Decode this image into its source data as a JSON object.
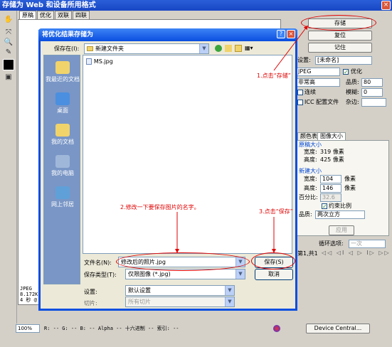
{
  "window": {
    "title": "存储为 Web 和设备所用格式",
    "close": "×"
  },
  "preview_tabs": [
    "原稿",
    "优化",
    "双联",
    "四联"
  ],
  "preview_info": [
    "JPEG",
    "8.172K",
    "4 秒 @"
  ],
  "right_panel": {
    "save_button": "存储",
    "reset_button": "复位",
    "remember_button": "记住",
    "preset_label": "设置:",
    "preset_value": "[未命名]",
    "format_value": "JPEG",
    "optimized_label": "优化",
    "quality_preset": "非常高",
    "quality_label": "品质:",
    "quality_value": "80",
    "progressive_label": "连续",
    "blur_label": "模糊:",
    "blur_value": "0",
    "icc_label": "ICC 配置文件",
    "matte_label": "杂边:",
    "tabs": [
      "颜色表",
      "图像大小"
    ],
    "original_size_title": "原稿大小",
    "orig_width_label": "宽度:",
    "orig_width_value": "319 像素",
    "orig_height_label": "高度:",
    "orig_height_value": "425 像素",
    "new_size_title": "新建大小",
    "new_width_label": "宽度:",
    "new_width_value": "104",
    "new_width_unit": "像素",
    "new_height_label": "高度:",
    "new_height_value": "146",
    "new_height_unit": "像素",
    "percent_label": "百分比:",
    "percent_value": "32.6",
    "constrain_label": "约束比例",
    "quality2_label": "品质:",
    "quality2_value": "两次立方",
    "apply_button": "应用",
    "loop_label": "循环选项:",
    "loop_value": "一次",
    "frame_label": "第1,共1",
    "device_central_button": "Device Central..."
  },
  "status_bar": {
    "zoom": "100%",
    "readout": "R: -- G: -- B: -- Alpha -- 十六进制 -- 索引: --"
  },
  "dialog": {
    "title": "将优化结果存储为",
    "help": "?",
    "close": "×",
    "save_in_label": "保存在(I):",
    "save_in_value": "新建文件夹",
    "places": [
      "我最近的文档",
      "桌面",
      "我的文档",
      "我的电脑",
      "网上邻居"
    ],
    "files": [
      "MS.jpg"
    ],
    "filename_label": "文件名(N):",
    "filename_value": "修改后的照片.jpg",
    "filetype_label": "保存类型(T):",
    "filetype_value": "仅限图像 (*.jpg)",
    "settings_label": "设置:",
    "settings_value": "默认设置",
    "slices_label": "切片:",
    "slices_value": "所有切片",
    "save_button": "保存(S)",
    "cancel_button": "取消"
  },
  "annotations": {
    "step1": "1.点击“存储”",
    "step2": "2.修改一下要保存图片的名字。",
    "step3": "3.点击“保存”"
  },
  "colors": {
    "annotation": "#e00000",
    "title_bar": "#0a4ee0"
  }
}
